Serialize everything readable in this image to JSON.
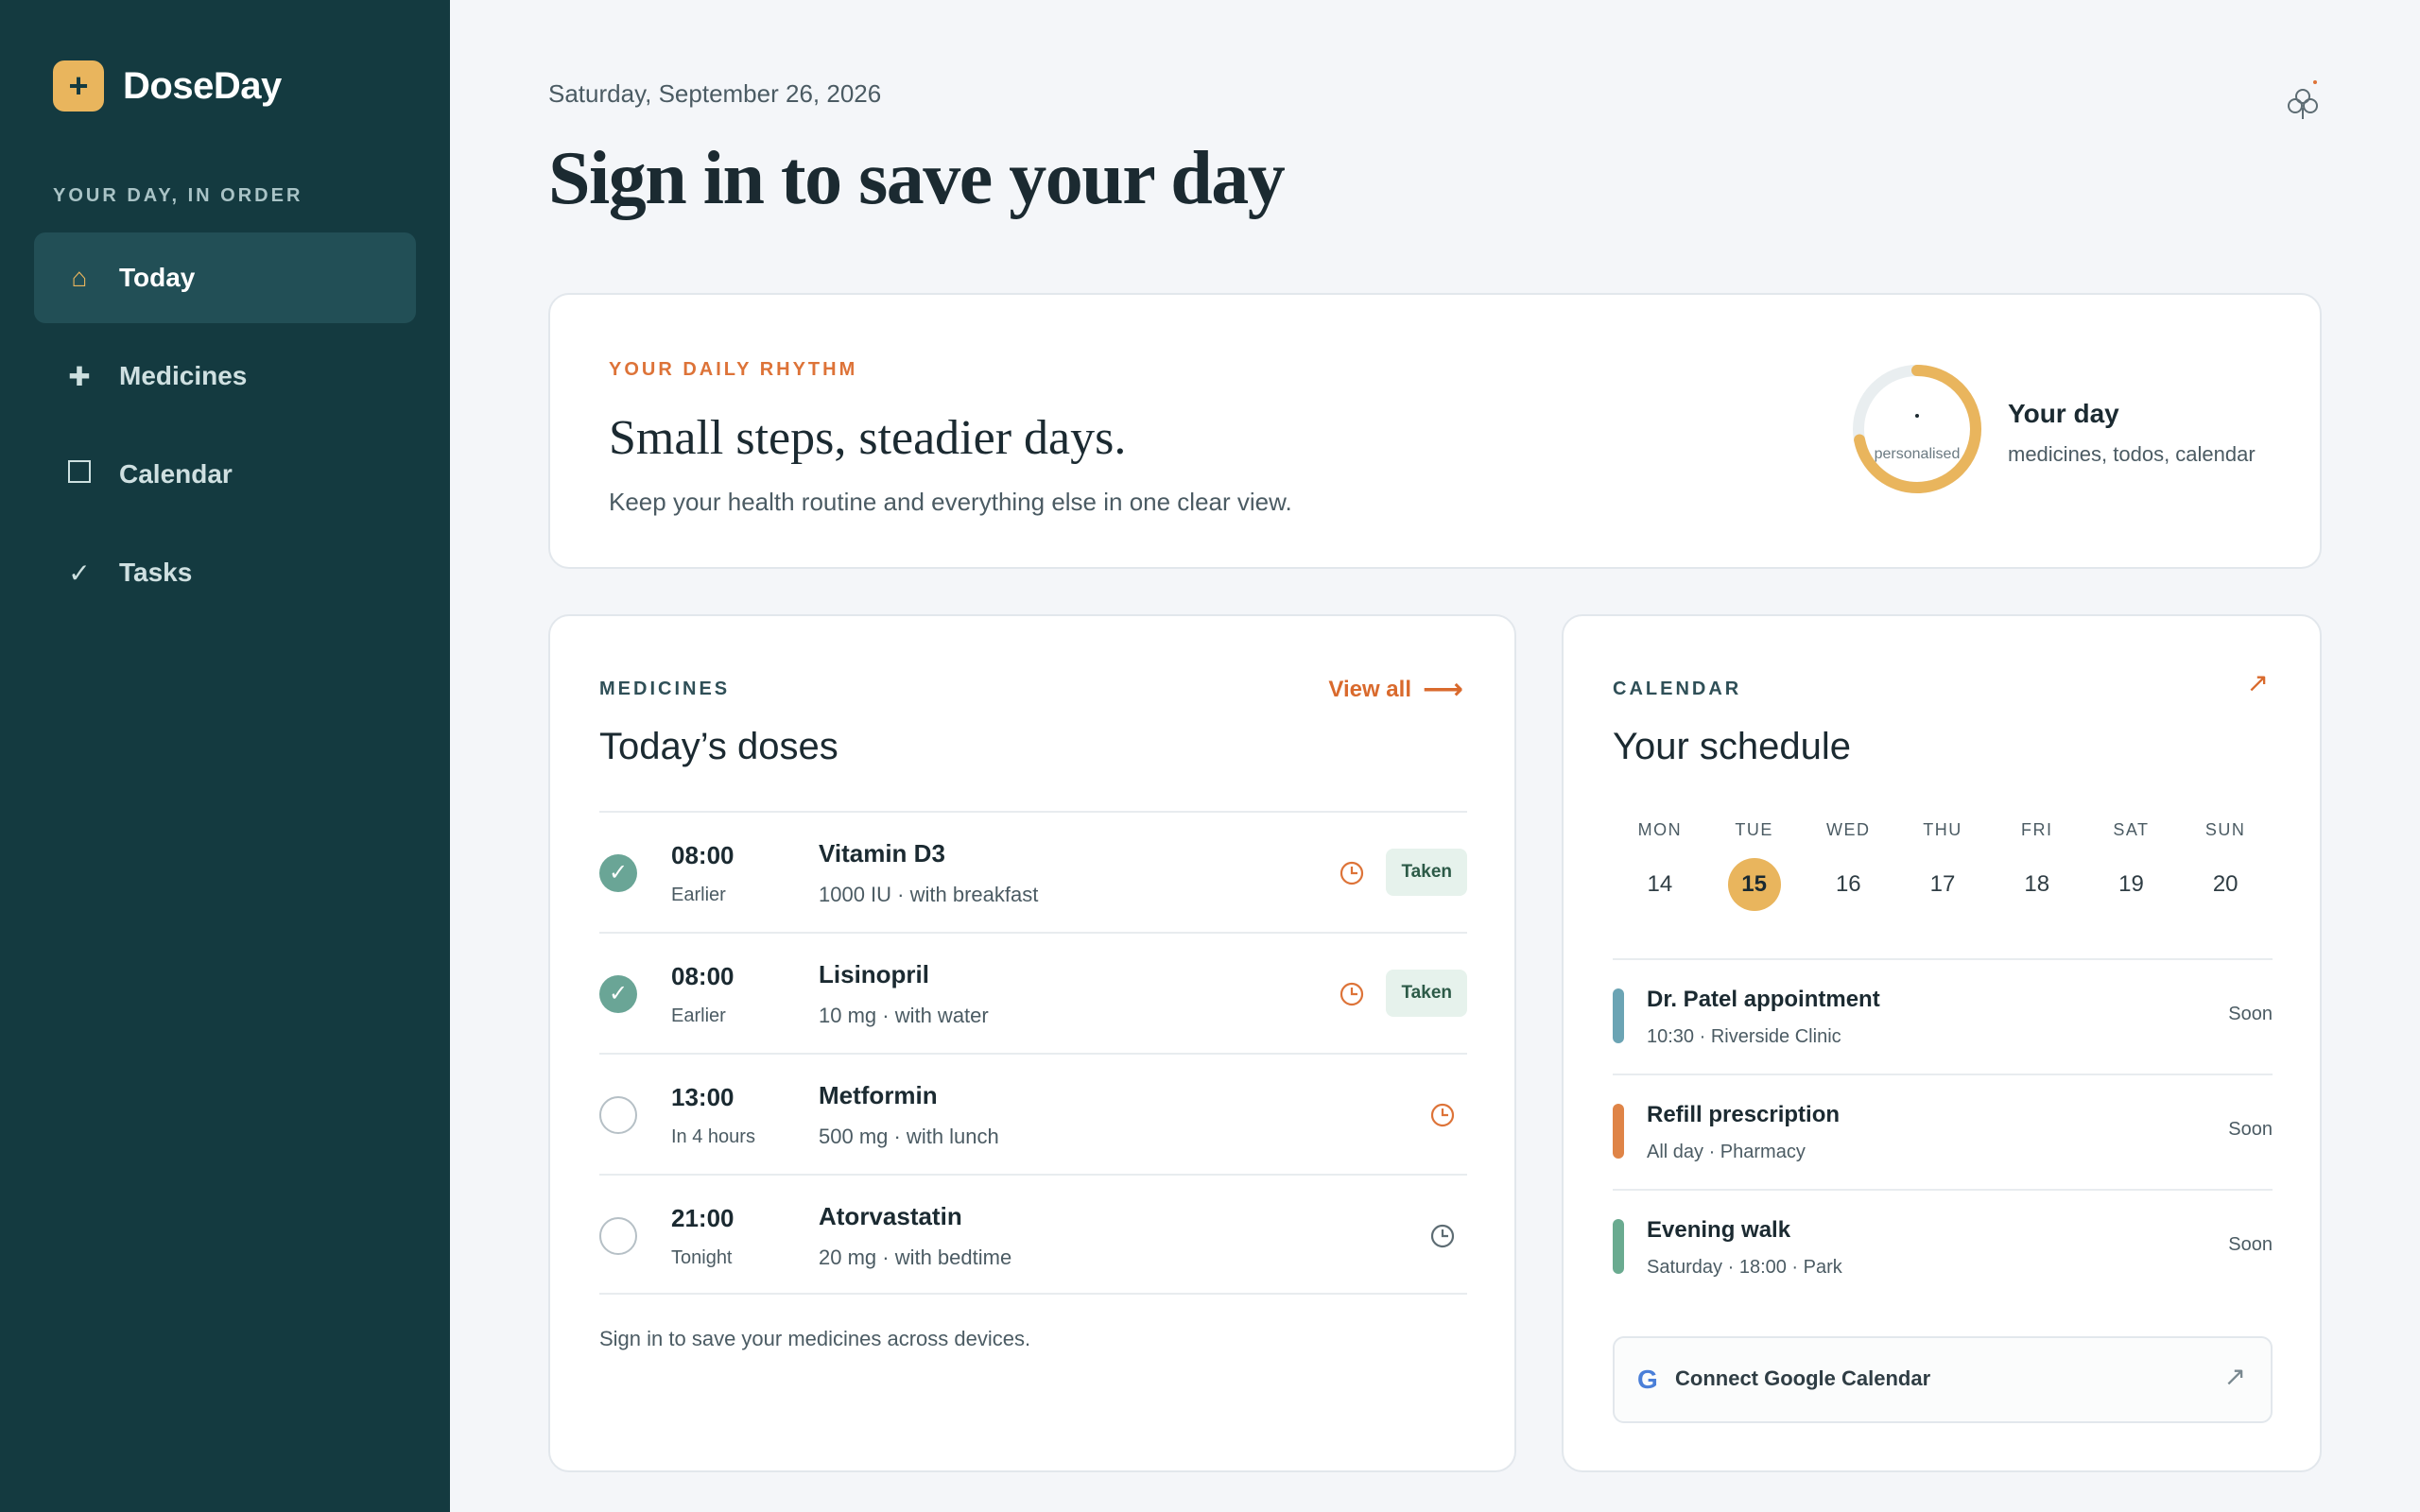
{
  "brand": {
    "mark": "+",
    "name": "DoseDay"
  },
  "sidebar": {
    "section_label": "YOUR DAY, IN ORDER",
    "items": [
      {
        "label": "Today",
        "icon": "home-icon",
        "glyph": "⌂",
        "active": true
      },
      {
        "label": "Medicines",
        "icon": "plus-icon",
        "glyph": "✚",
        "active": false
      },
      {
        "label": "Calendar",
        "icon": "square-icon",
        "glyph": "",
        "active": false
      },
      {
        "label": "Tasks",
        "icon": "check-icon",
        "glyph": "✓",
        "active": false
      }
    ]
  },
  "header": {
    "date": "Saturday, September 26, 2026",
    "title": "Sign in to save your day"
  },
  "rhythm": {
    "eyebrow": "YOUR DAILY RHYTHM",
    "title": "Small steps, steadier days.",
    "subtitle": "Keep your health routine and everything else in one clear view.",
    "ring_label": "personalised",
    "ring_progress": 0.72,
    "day_title": "Your day",
    "day_subtitle": "medicines, todos, calendar"
  },
  "medicines": {
    "eyebrow": "MEDICINES",
    "view_all": "View all",
    "title": "Today’s doses",
    "doses": [
      {
        "time": "08:00",
        "when": "Earlier",
        "name": "Vitamin D3",
        "detail": "1000 IU · with breakfast",
        "taken": true,
        "badge": "Taken"
      },
      {
        "time": "08:00",
        "when": "Earlier",
        "name": "Lisinopril",
        "detail": "10 mg · with water",
        "taken": true,
        "badge": "Taken"
      },
      {
        "time": "13:00",
        "when": "In 4 hours",
        "name": "Metformin",
        "detail": "500 mg · with lunch",
        "taken": false,
        "badge": ""
      },
      {
        "time": "21:00",
        "when": "Tonight",
        "name": "Atorvastatin",
        "detail": "20 mg · with bedtime",
        "taken": false,
        "badge": ""
      }
    ],
    "footer": "Sign in to save your medicines across devices."
  },
  "calendar": {
    "eyebrow": "CALENDAR",
    "title": "Your schedule",
    "week": [
      {
        "name": "MON",
        "num": "14"
      },
      {
        "name": "TUE",
        "num": "15",
        "selected": true
      },
      {
        "name": "WED",
        "num": "16"
      },
      {
        "name": "THU",
        "num": "17"
      },
      {
        "name": "FRI",
        "num": "18"
      },
      {
        "name": "SAT",
        "num": "19"
      },
      {
        "name": "SUN",
        "num": "20"
      }
    ],
    "events": [
      {
        "title": "Dr. Patel appointment",
        "meta": "10:30 · Riverside Clinic",
        "status": "Soon",
        "color": "#6ba4b4"
      },
      {
        "title": "Refill prescription",
        "meta": "All day · Pharmacy",
        "status": "Soon",
        "color": "#df8447"
      },
      {
        "title": "Evening walk",
        "meta": "Saturday · 18:00 · Park",
        "status": "Soon",
        "color": "#6aab90"
      }
    ],
    "connect": {
      "icon_letter": "G",
      "label": "Connect Google Calendar"
    }
  },
  "colors": {
    "sidebar_bg": "#143a40",
    "accent_gold": "#e9b55d",
    "accent_orange": "#dd7338",
    "taken_green": "#6aa596"
  }
}
